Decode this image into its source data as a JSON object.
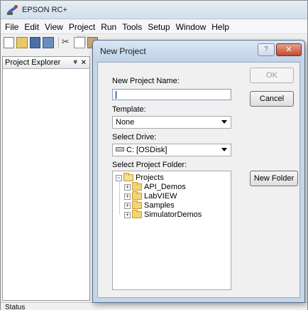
{
  "app": {
    "title": "EPSON RC+"
  },
  "menu": [
    "File",
    "Edit",
    "View",
    "Project",
    "Run",
    "Tools",
    "Setup",
    "Window",
    "Help"
  ],
  "explorer": {
    "title": "Project Explorer",
    "pin": "ᵠ",
    "close": "✕"
  },
  "status": {
    "text": "Status"
  },
  "dialog": {
    "title": "New Project",
    "help": "?",
    "close": "✕",
    "name_label": "New Project Name:",
    "name_value": "",
    "template_label": "Template:",
    "template_value": "None",
    "drive_label": "Select Drive:",
    "drive_value": "C: [OSDisk]",
    "folder_label": "Select Project Folder:",
    "ok_label": "OK",
    "cancel_label": "Cancel",
    "new_folder_label": "New Folder",
    "tree": {
      "root": "Projects",
      "children": [
        "API_Demos",
        "LabVIEW",
        "Samples",
        "SimulatorDemos"
      ]
    }
  }
}
